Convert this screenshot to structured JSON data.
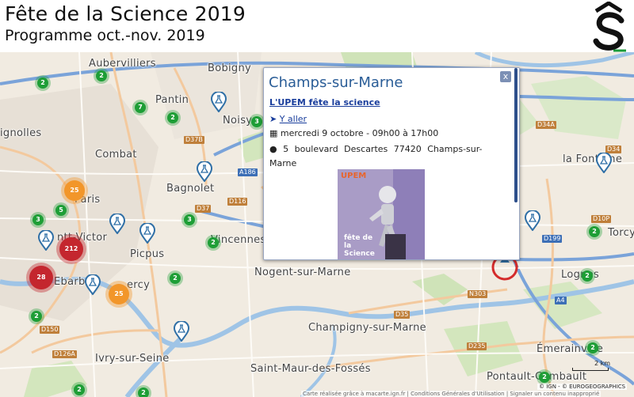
{
  "header": {
    "title": "Fête de la Science 2019",
    "subtitle": "Programme oct.-nov. 2019"
  },
  "map": {
    "places": [
      "Aubervilliers",
      "Bobigny",
      "Pantin",
      "Noisy",
      "Combat",
      "Bagnolet",
      "Paris",
      "Vincennes",
      "Picpus",
      "Nogent-sur-Marne",
      "Champigny-sur-Marne",
      "Ivry-sur-Seine",
      "Saint-Maur-des-Fossés",
      "Lognes",
      "Émerainville",
      "Pontault-Combault",
      "la Fontaine",
      "Torcy",
      "ignolles",
      "ntt-Victor",
      "Ebarb",
      "ercy"
    ],
    "roads": [
      "D34A",
      "D37B",
      "A186",
      "D37",
      "D116",
      "D10P",
      "D199",
      "N303",
      "D35",
      "A4",
      "D150",
      "D126A",
      "D235",
      "D34"
    ],
    "cluster_counts": [
      "2",
      "2",
      "7",
      "2",
      "3",
      "3",
      "5",
      "3",
      "2",
      "2",
      "2",
      "2",
      "2",
      "2",
      "2",
      "2",
      "2",
      "25",
      "212",
      "28",
      "25"
    ],
    "selected_marker_icon": "selected-location-icon",
    "scale_label": "2 km",
    "copyright": "© IGN - © EUROGEOGRAPHICS",
    "attribution": "Carte réalisée grâce à macarte.ign.fr | Conditions Générales d'Utilisation | Signaler un contenu inapproprié"
  },
  "popup": {
    "title": "Champs-sur-Marne",
    "link": "L'UPEM fête la science",
    "directions": "Y aller",
    "date": "mercredi 9 octobre - 09h00 à 17h00",
    "address": "5 boulevard Descartes 77420 Champs-sur-Marne",
    "close": "x",
    "poster_upem": "UPEM",
    "poster_title": "fête de la Science"
  },
  "colors": {
    "cluster_green": "#1e9e36",
    "cluster_orange": "#f2962a",
    "cluster_red": "#c4262e",
    "poi_blue": "#2f6fa6",
    "selected_ring": "#d42b2b",
    "popup_title": "#2a5d97"
  }
}
